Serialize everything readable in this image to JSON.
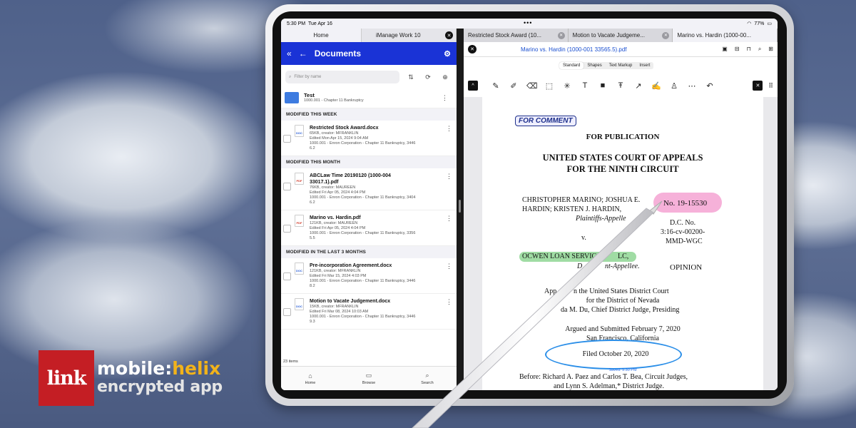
{
  "status": {
    "time": "5:30 PM",
    "date": "Tue Apr 16",
    "battery": "77%"
  },
  "left_tabs": [
    {
      "label": "Home"
    },
    {
      "label": "iManage Work 10"
    }
  ],
  "left_header": {
    "title": "Documents"
  },
  "search": {
    "placeholder": "Filter by name"
  },
  "folder": {
    "name": "Test",
    "sub": "1000.001 - Chapter 11 Bankruptcy"
  },
  "sections": [
    {
      "title": "MODIFIED THIS WEEK",
      "items": [
        {
          "name": "Restricted Stock Award.docx",
          "type": "DOC",
          "l1": "65KB, creator: MFRANKLIN",
          "l2": "Edited Mon Apr 15, 2024 9:04 AM",
          "l3": "1000.001 - Enron Corporation - Chapter 11 Bankruptcy, 3446",
          "l4": "6.2"
        }
      ]
    },
    {
      "title": "MODIFIED THIS MONTH",
      "items": [
        {
          "name": "ABCLaw Time 20190120 (1000-004",
          "name2": "33017.1).pdf",
          "type": "PDF",
          "l1": "76KB, creator: MAUREEN",
          "l2": "Edited Fri Apr 05, 2024 4:04 PM",
          "l3": "1000.001 - Enron Corporation - Chapter 11 Bankruptcy, 3404",
          "l4": "6.2"
        },
        {
          "name": "Marino vs. Hardin.pdf",
          "type": "PDF",
          "l1": "121KB, creator: MAUREEN",
          "l2": "Edited Fri Apr 05, 2024 4:04 PM",
          "l3": "1000.001 - Enron Corporation - Chapter 11 Bankruptcy, 3356",
          "l4": "5.5"
        }
      ]
    },
    {
      "title": "MODIFIED IN THE LAST 3 MONTHS",
      "items": [
        {
          "name": "Pre-incorporation Agreement.docx",
          "type": "DOC",
          "l1": "121KB, creator: MFRANKLIN",
          "l2": "Edited Fri Mar 15, 2024 4:03 PM",
          "l3": "1000.001 - Enron Corporation - Chapter 11 Bankruptcy, 3446",
          "l4": "8.2"
        },
        {
          "name": "Motion to Vacate Judgement.docx",
          "type": "DOC",
          "l1": "15KB, creator: MFRANKLIN",
          "l2": "Edited Fri Mar 08, 2024 10:03 AM",
          "l3": "1000.001 - Enron Corporation - Chapter 11 Bankruptcy, 3446",
          "l4": "9.3"
        }
      ]
    }
  ],
  "items_count": "23 items",
  "bottom_nav": [
    {
      "label": "Home"
    },
    {
      "label": "Browse"
    },
    {
      "label": "Search"
    }
  ],
  "right_tabs": [
    {
      "label": "Restricted Stock Award (10..."
    },
    {
      "label": "Motion to Vacate Judgeme..."
    },
    {
      "label": "Marino vs. Hardin (1000-00..."
    }
  ],
  "doc_title": "Marino vs. Hardin (1000-001 33565.5).pdf",
  "markup_tabs": [
    {
      "label": "Standard"
    },
    {
      "label": "Shapes"
    },
    {
      "label": "Text Markup"
    },
    {
      "label": "Insert"
    }
  ],
  "page": {
    "stamp": "FOR COMMENT",
    "publication": "FOR PUBLICATION",
    "court1": "UNITED STATES COURT OF APPEALS",
    "court2": "FOR THE NINTH CIRCUIT",
    "p1": "CHRISTOPHER MARINO; JOSHUA E.",
    "p2": "HARDIN; KRISTEN J. HARDIN,",
    "p3": "Plaintiffs-Appelle",
    "v": "v.",
    "d1": "OCWEN LOAN SERVIC",
    "d1b": "LC,",
    "d2": "D",
    "d2b": "nt-Appellee.",
    "no": "No. 19-15530",
    "dc1": "D.C. No.",
    "dc2": "3:16-cv-00200-",
    "dc3": "MMD-WGC",
    "opinion": "OPINION",
    "a1": "App",
    "a1b": "n the United States District Court",
    "a2": "for the District of Nevada",
    "a3": "da M. Du, Chief District Judge, Presiding",
    "argued": "Argued and Submitted February 7, 2020",
    "city": "San Francisco, California",
    "filed": "Filed October 20, 2020",
    "saved": "Saved: 5:30 PM",
    "before1": "Before: Richard A. Paez and Carlos T. Bea, Circuit Judges,",
    "before2": "and Lynn S. Adelman,* District Judge."
  },
  "logo": {
    "box": "link",
    "w1a": "mobile",
    "w1b": "helix",
    "w2": "encrypted app"
  }
}
